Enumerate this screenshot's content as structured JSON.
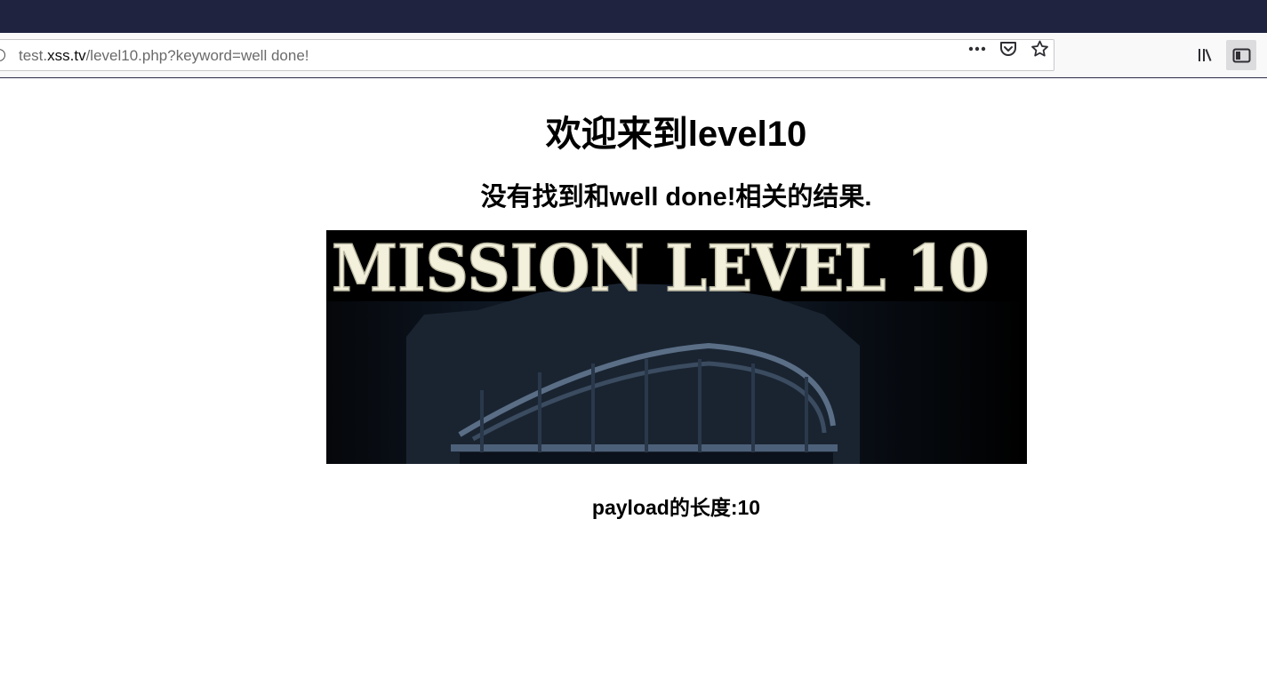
{
  "browser": {
    "url": {
      "prefix": "test.",
      "host": "xss.tv",
      "path": "/level10.php?keyword=well done!"
    }
  },
  "page": {
    "heading": "欢迎来到level10",
    "result_message": "没有找到和well done!相关的结果.",
    "banner_text": "MISSION LEVEL 10",
    "payload_length": "payload的长度:10"
  },
  "icons": {
    "site_info": "info-icon",
    "page_actions": "more-icon",
    "pocket": "pocket-icon",
    "bookmark": "star-icon",
    "library": "library-icon",
    "sidebar": "sidebar-icon"
  }
}
